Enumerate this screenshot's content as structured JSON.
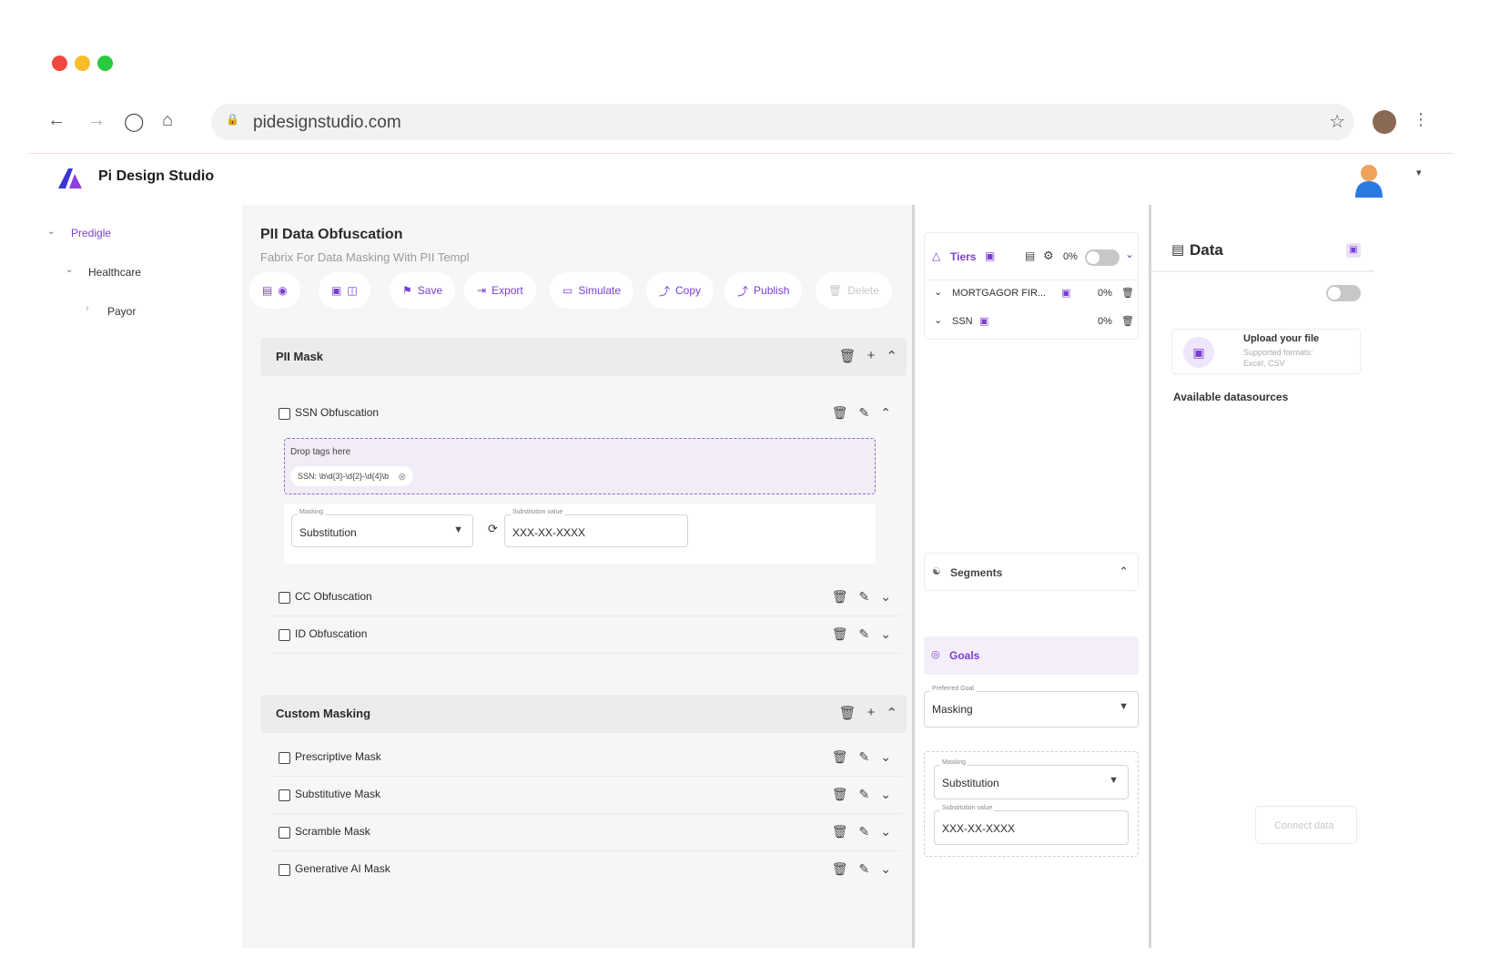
{
  "browser": {
    "url": "pidesignstudio.com",
    "traffic_lights": [
      "#f0473f",
      "#f9bd2c",
      "#29c940"
    ]
  },
  "app": {
    "brand": "Pi Design Studio",
    "brand_color": "#6b3fd6"
  },
  "sidebar": {
    "items": [
      {
        "label": "Predigle"
      },
      {
        "label": "Healthcare"
      },
      {
        "label": "Payor"
      }
    ]
  },
  "main": {
    "title": "PII Data Obfuscation",
    "subtitle": "Fabrix For Data Masking With PII Templ",
    "toolbar": {
      "save": "Save",
      "export": "Export",
      "simulate": "Simulate",
      "copy": "Copy",
      "publish": "Publish",
      "delete": "Delete"
    },
    "sections": [
      {
        "title": "PII Mask",
        "rows": [
          {
            "label": "SSN Obfuscation"
          },
          {
            "label": "CC Obfuscation"
          },
          {
            "label": "ID Obfuscation"
          }
        ]
      },
      {
        "title": "Custom Masking",
        "rows": [
          {
            "label": "Prescriptive Mask"
          },
          {
            "label": "Substitutive Mask"
          },
          {
            "label": "Scramble Mask"
          },
          {
            "label": "Generative AI Mask"
          }
        ]
      }
    ],
    "ssn_detail": {
      "drop_label": "Drop tags here",
      "tag": "SSN: \\b\\d{3}-\\d{2}-\\d{4}\\b",
      "masking_label": "Masking",
      "masking_value": "Substitution",
      "substitution_label": "Substitution value",
      "substitution_value": "XXX-XX-XXXX"
    }
  },
  "middle": {
    "tiers_label": "Tiers",
    "tiers_percent": "0%",
    "tier_rows": [
      {
        "label": "MORTGAGOR FIR...",
        "percent": "0%"
      },
      {
        "label": "SSN",
        "percent": "0%"
      }
    ],
    "segments_label": "Segments",
    "goals_label": "Goals",
    "preferred_goal_label": "Preferred Goal",
    "preferred_goal_value": "Masking",
    "masking_label": "Masking",
    "masking_value": "Substitution",
    "substitution_label": "Substitution value",
    "substitution_value": "XXX-XX-XXXX"
  },
  "right": {
    "title": "Data",
    "upload_title": "Upload your file",
    "upload_formats_1": "Supported formats:",
    "upload_formats_2": "Excel, CSV",
    "available": "Available datasources",
    "connect": "Connect data"
  }
}
